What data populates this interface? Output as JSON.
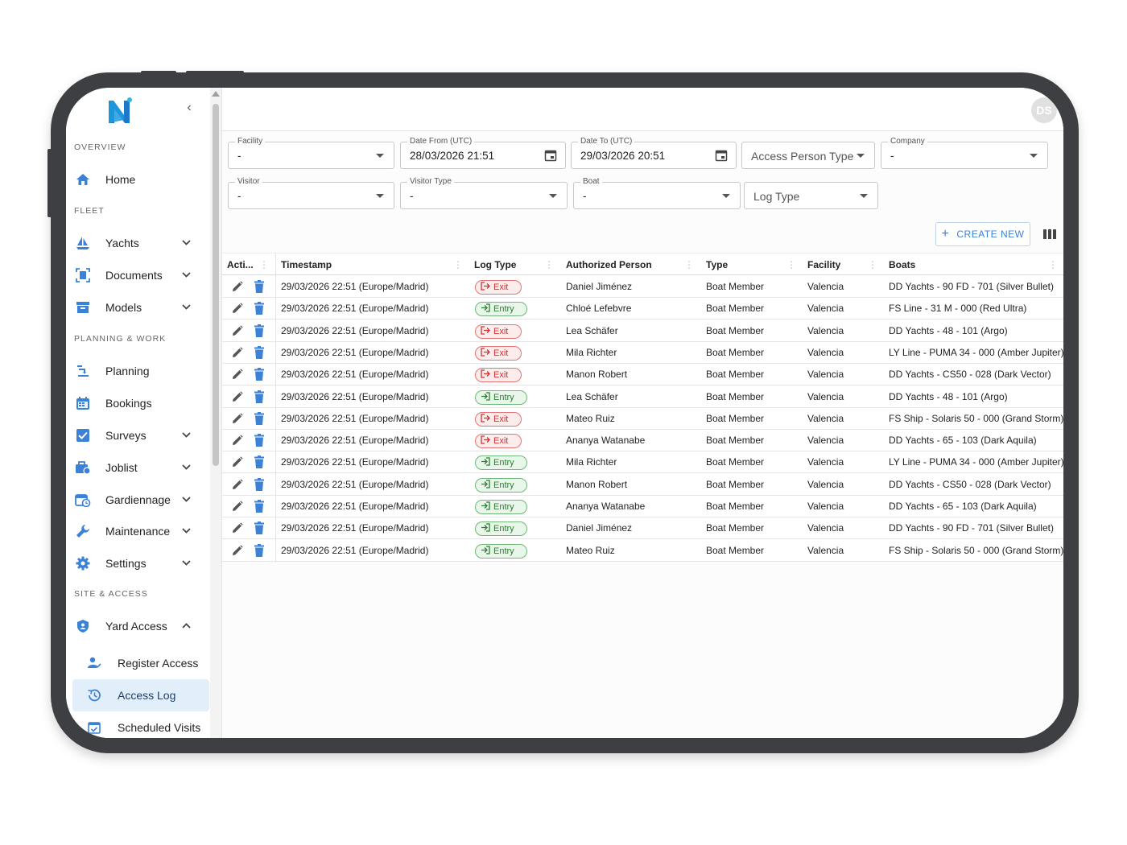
{
  "app": {
    "avatar_initials": "DS",
    "accent": "#3b82d6"
  },
  "sidebar": {
    "sections": {
      "overview": "OVERVIEW",
      "fleet": "FLEET",
      "planning": "PLANNING & WORK",
      "site": "SITE & ACCESS"
    },
    "items": {
      "home": "Home",
      "yachts": "Yachts",
      "documents": "Documents",
      "models": "Models",
      "planning": "Planning",
      "bookings": "Bookings",
      "surveys": "Surveys",
      "joblist": "Joblist",
      "gardiennage": "Gardiennage",
      "maintenance": "Maintenance",
      "settings": "Settings",
      "yard_access": "Yard Access",
      "register_access": "Register Access",
      "access_log": "Access Log",
      "scheduled_visits": "Scheduled Visits"
    }
  },
  "filters": {
    "facility": {
      "label": "Facility",
      "value": "-"
    },
    "date_from": {
      "label": "Date From (UTC)",
      "value": "28/03/2026 21:51"
    },
    "date_to": {
      "label": "Date To (UTC)",
      "value": "29/03/2026 20:51"
    },
    "access_person_type": {
      "placeholder": "Access Person Type"
    },
    "company": {
      "label": "Company",
      "value": "-"
    },
    "visitor": {
      "label": "Visitor",
      "value": "-"
    },
    "visitor_type": {
      "label": "Visitor Type",
      "value": "-"
    },
    "boat": {
      "label": "Boat",
      "value": "-"
    },
    "log_type": {
      "placeholder": "Log Type"
    }
  },
  "toolbar": {
    "create_label": "CREATE NEW"
  },
  "table": {
    "headers": {
      "actions": "Acti...",
      "timestamp": "Timestamp",
      "log_type": "Log Type",
      "person": "Authorized Person",
      "type": "Type",
      "facility": "Facility",
      "boats": "Boats"
    },
    "rows": [
      {
        "timestamp": "29/03/2026 22:51 (Europe/Madrid)",
        "log": "Exit",
        "person": "Daniel Jiménez",
        "type": "Boat Member",
        "facility": "Valencia",
        "boat": "DD Yachts - 90 FD - 701 (Silver Bullet)"
      },
      {
        "timestamp": "29/03/2026 22:51 (Europe/Madrid)",
        "log": "Entry",
        "person": "Chloé Lefebvre",
        "type": "Boat Member",
        "facility": "Valencia",
        "boat": "FS Line - 31 M - 000 (Red Ultra)"
      },
      {
        "timestamp": "29/03/2026 22:51 (Europe/Madrid)",
        "log": "Exit",
        "person": "Lea Schäfer",
        "type": "Boat Member",
        "facility": "Valencia",
        "boat": "DD Yachts - 48 - 101 (Argo)"
      },
      {
        "timestamp": "29/03/2026 22:51 (Europe/Madrid)",
        "log": "Exit",
        "person": "Mila Richter",
        "type": "Boat Member",
        "facility": "Valencia",
        "boat": "LY Line - PUMA 34 - 000 (Amber Jupiter)"
      },
      {
        "timestamp": "29/03/2026 22:51 (Europe/Madrid)",
        "log": "Exit",
        "person": "Manon Robert",
        "type": "Boat Member",
        "facility": "Valencia",
        "boat": "DD Yachts - CS50 - 028 (Dark Vector)"
      },
      {
        "timestamp": "29/03/2026 22:51 (Europe/Madrid)",
        "log": "Entry",
        "person": "Lea Schäfer",
        "type": "Boat Member",
        "facility": "Valencia",
        "boat": "DD Yachts - 48 - 101 (Argo)"
      },
      {
        "timestamp": "29/03/2026 22:51 (Europe/Madrid)",
        "log": "Exit",
        "person": "Mateo Ruiz",
        "type": "Boat Member",
        "facility": "Valencia",
        "boat": "FS Ship - Solaris 50 - 000 (Grand Storm)"
      },
      {
        "timestamp": "29/03/2026 22:51 (Europe/Madrid)",
        "log": "Exit",
        "person": "Ananya Watanabe",
        "type": "Boat Member",
        "facility": "Valencia",
        "boat": "DD Yachts - 65 - 103 (Dark Aquila)"
      },
      {
        "timestamp": "29/03/2026 22:51 (Europe/Madrid)",
        "log": "Entry",
        "person": "Mila Richter",
        "type": "Boat Member",
        "facility": "Valencia",
        "boat": "LY Line - PUMA 34 - 000 (Amber Jupiter)"
      },
      {
        "timestamp": "29/03/2026 22:51 (Europe/Madrid)",
        "log": "Entry",
        "person": "Manon Robert",
        "type": "Boat Member",
        "facility": "Valencia",
        "boat": "DD Yachts - CS50 - 028 (Dark Vector)"
      },
      {
        "timestamp": "29/03/2026 22:51 (Europe/Madrid)",
        "log": "Entry",
        "person": "Ananya Watanabe",
        "type": "Boat Member",
        "facility": "Valencia",
        "boat": "DD Yachts - 65 - 103 (Dark Aquila)"
      },
      {
        "timestamp": "29/03/2026 22:51 (Europe/Madrid)",
        "log": "Entry",
        "person": "Daniel Jiménez",
        "type": "Boat Member",
        "facility": "Valencia",
        "boat": "DD Yachts - 90 FD - 701 (Silver Bullet)"
      },
      {
        "timestamp": "29/03/2026 22:51 (Europe/Madrid)",
        "log": "Entry",
        "person": "Mateo Ruiz",
        "type": "Boat Member",
        "facility": "Valencia",
        "boat": "FS Ship - Solaris 50 - 000 (Grand Storm)"
      }
    ]
  }
}
